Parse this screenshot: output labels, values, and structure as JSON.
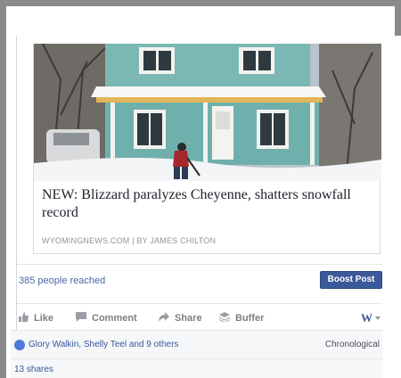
{
  "post": {
    "headline": "NEW: Blizzard paralyzes Cheyenne, shatters snowfall record",
    "source": "WYOMINGNEWS.COM | BY JAMES CHILTON",
    "image_alt": "Person shoveling snow in front of a teal house"
  },
  "insights": {
    "reach": "385 people reached",
    "boost_label": "Boost Post"
  },
  "actions": {
    "like": "Like",
    "comment": "Comment",
    "share": "Share",
    "buffer": "Buffer",
    "brand_glyph": "W"
  },
  "reactions": {
    "names": "Glory Walkin, Shelly Teel and 9 others",
    "order": "Chronological"
  },
  "shares": "13 shares",
  "colors": {
    "accent": "#3b5998",
    "link": "#365899",
    "muted": "#90949c"
  }
}
